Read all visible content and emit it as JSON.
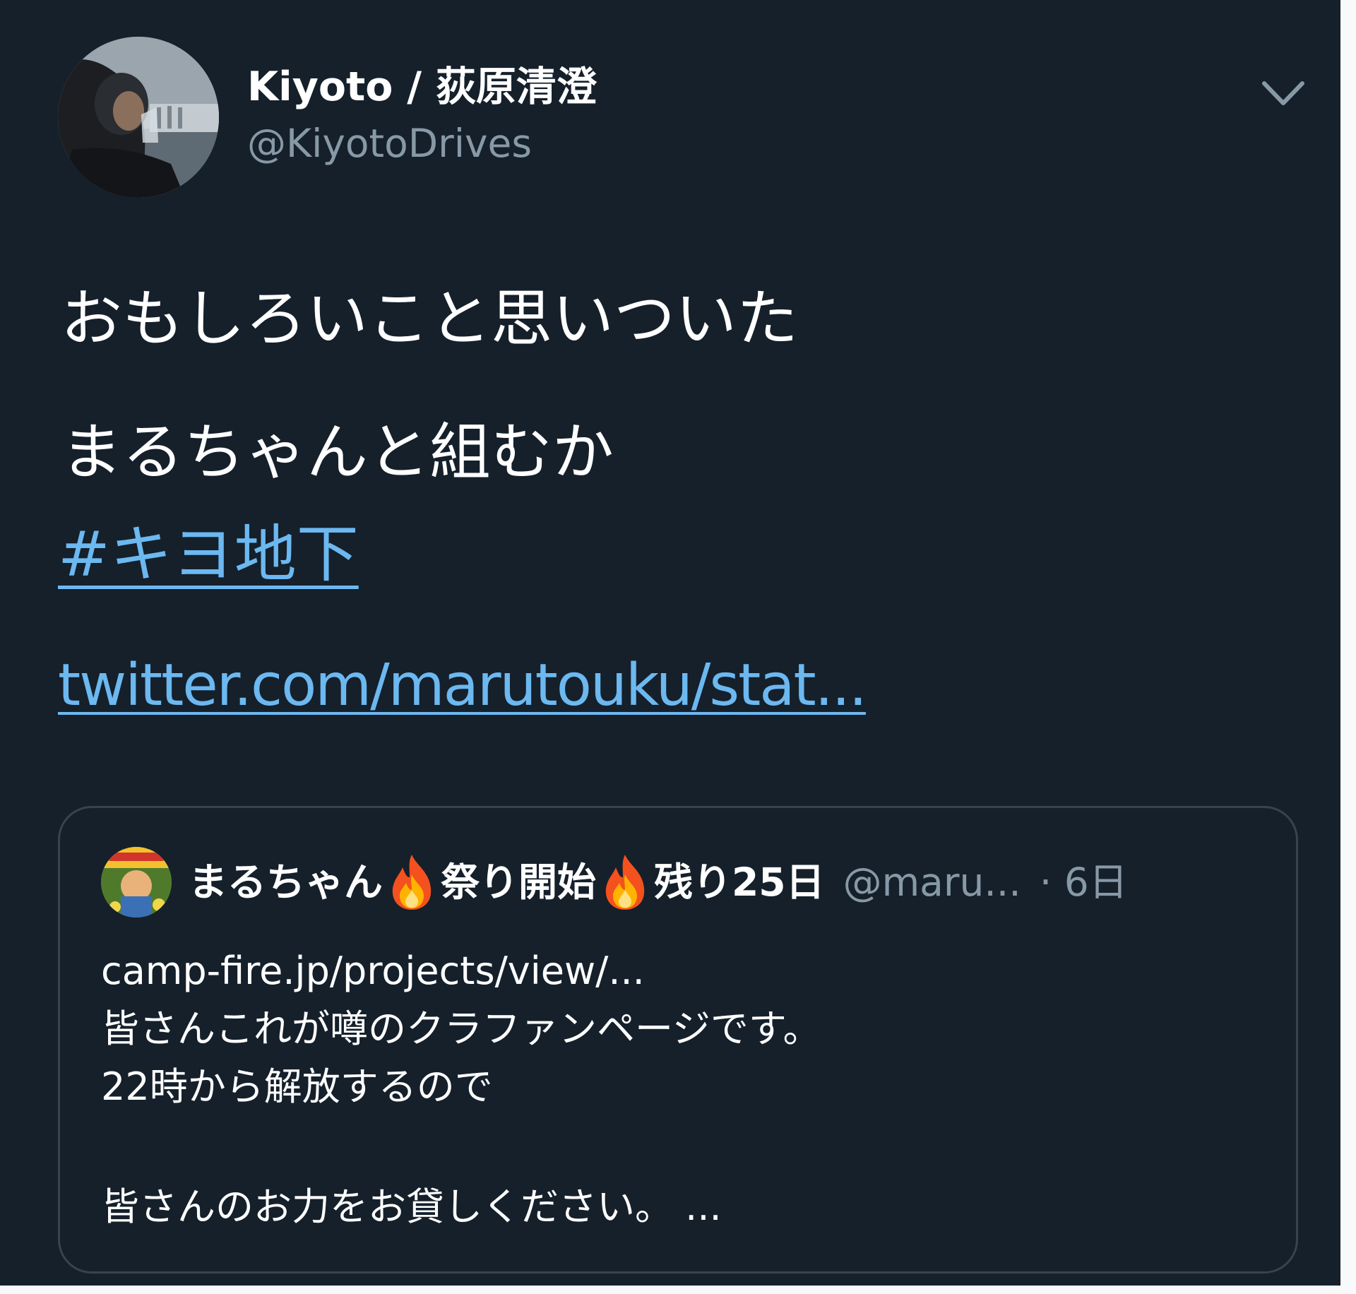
{
  "tweet": {
    "author": {
      "display_name": "Kiyoto / 荻原清澄",
      "handle": "@KiyotoDrives"
    },
    "text_lines": [
      "おもしろいこと思いついた",
      "まるちゃんと組むか"
    ],
    "hashtag": "#キヨ地下",
    "link": "twitter.com/marutouku/stat..."
  },
  "quoted_tweet": {
    "name_part1": "まるちゃん",
    "name_part2": "祭り開始",
    "name_part3": "残り25日",
    "handle": "@maru...",
    "date": "· 6日",
    "body_lines": [
      "camp-fire.jp/projects/view/...",
      "皆さんこれが噂のクラファンページです。",
      "22時から解放するので",
      "",
      "皆さんのお力をお貸しください。 ..."
    ]
  },
  "icons": {
    "caret": "chevron-down-icon",
    "fire": "fire-emoji-icon"
  },
  "colors": {
    "background": "#15202b",
    "link": "#6cb8f0",
    "secondary_text": "#8899a6",
    "border": "#38444d"
  }
}
